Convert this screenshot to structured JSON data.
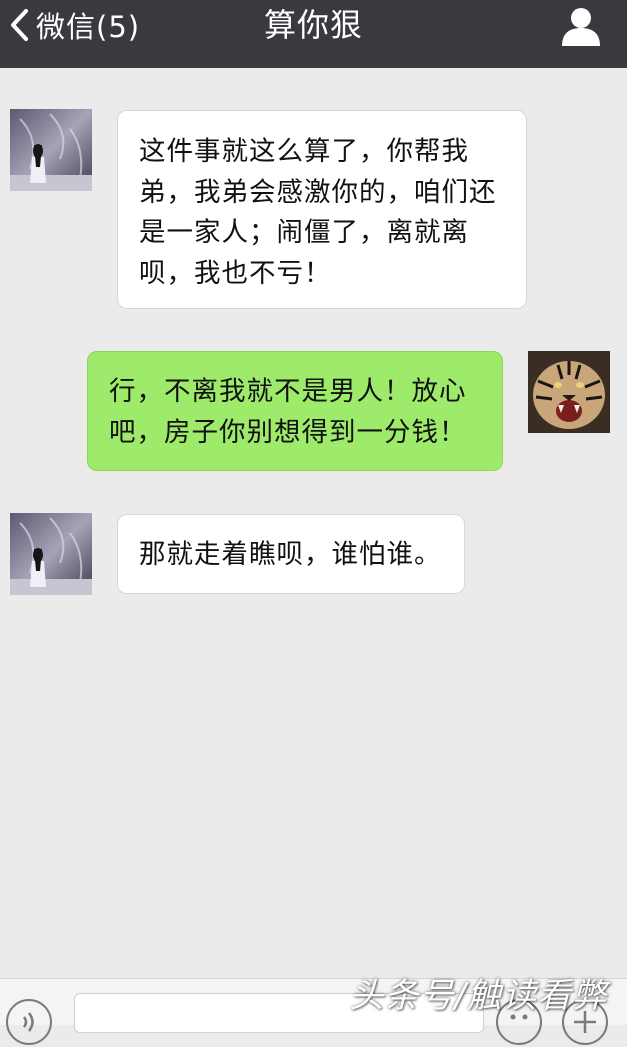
{
  "header": {
    "back_label": "微信(5)",
    "title": "算你狠"
  },
  "messages": [
    {
      "side": "left",
      "lines": [
        "这件事就这么算了，你帮我",
        "弟，我弟会感激你的，咱们还",
        "是一家人；闹僵了，离就离",
        "呗，我也不亏！"
      ]
    },
    {
      "side": "right",
      "lines": [
        "行，不离我就不是男人！放心",
        "吧，房子你别想得到一分钱！"
      ]
    },
    {
      "side": "left",
      "lines": [
        "那就走着瞧呗，谁怕谁。"
      ]
    }
  ],
  "watermark": "头条号/触读看弊",
  "colors": {
    "header_bg": "#393a3f",
    "chat_bg": "#ebebeb",
    "bubble_left": "#ffffff",
    "bubble_right": "#9eea6a"
  },
  "icons": {
    "back": "chevron-left-icon",
    "profile": "user-icon",
    "voice": "voice-icon",
    "emoji": "emoji-icon",
    "more": "plus-icon"
  }
}
